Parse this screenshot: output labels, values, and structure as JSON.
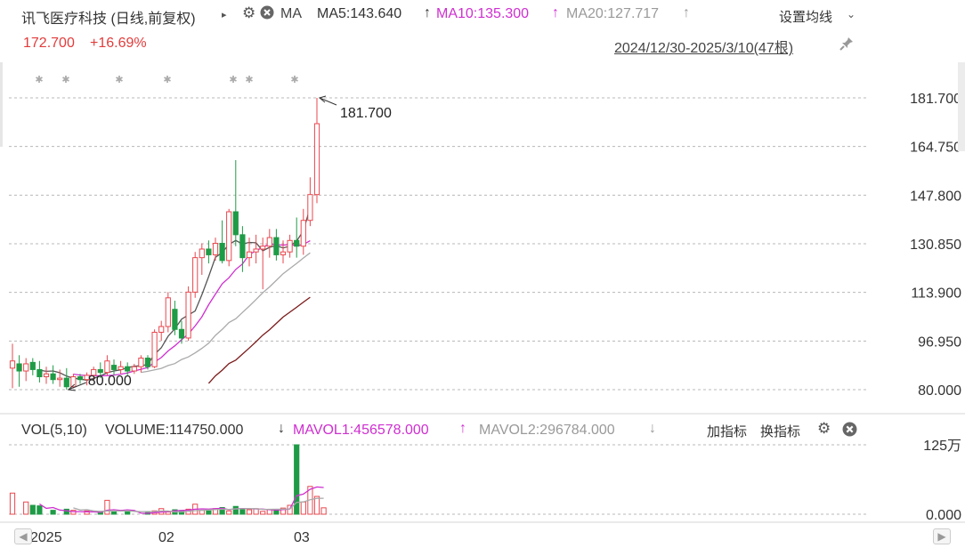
{
  "header": {
    "stock_title": "讯飞医疗科技 (日线,前复权)",
    "ma_label": "MA",
    "ma5": "MA5:143.640",
    "ma10": "MA10:135.300",
    "ma20": "MA20:127.717",
    "settings_label": "设置均线",
    "price": "172.700",
    "change_pct": "+16.69%",
    "date_range": "2024/12/30-2025/3/10(47根)"
  },
  "volume_header": {
    "vol_label": "VOL(5,10)",
    "volume": "VOLUME:114750.000",
    "mavol1": "MAVOL1:456578.000",
    "mavol2": "MAVOL2:296784.000",
    "add_indicator": "加指标",
    "switch_indicator": "换指标"
  },
  "x_axis_labels": [
    "2025",
    "02",
    "03"
  ],
  "colors": {
    "up": "#e8474e",
    "down": "#1e9b46",
    "ma5": "#555555",
    "ma10": "#cf2fd0",
    "ma20": "#aaaaaa",
    "ma60": "#7a1a1a",
    "price_text": "#e23c3c",
    "grid": "#bbbbbb"
  },
  "icons": [
    "triangle-right-icon",
    "gear-icon",
    "close-icon",
    "chevron-down-icon",
    "pin-icon",
    "arrow-up-icon",
    "arrow-down-icon",
    "scroll-left-icon",
    "scroll-right-icon"
  ],
  "chart_data": {
    "type": "candlestick",
    "price_axis": {
      "ticks": [
        "181.700",
        "164.750",
        "147.800",
        "130.850",
        "113.900",
        "96.950",
        "80.000"
      ],
      "ylim": [
        80,
        181.7
      ]
    },
    "volume_axis": {
      "ticks": [
        "125万",
        "0.000"
      ],
      "ylim": [
        0,
        1250000
      ]
    },
    "annotations": [
      {
        "label": "181.700",
        "type": "max"
      },
      {
        "label": "80.000",
        "type": "min"
      }
    ],
    "candles": [
      {
        "o": 87.5,
        "h": 96,
        "l": 80.5,
        "c": 90
      },
      {
        "o": 89,
        "h": 92,
        "l": 81,
        "c": 86.5
      },
      {
        "o": 86.5,
        "h": 91,
        "l": 83,
        "c": 89
      },
      {
        "o": 89.5,
        "h": 91,
        "l": 85,
        "c": 87
      },
      {
        "o": 87,
        "h": 90,
        "l": 82.5,
        "c": 84.5
      },
      {
        "o": 84.5,
        "h": 88,
        "l": 82,
        "c": 85.5
      },
      {
        "o": 85.5,
        "h": 88.5,
        "l": 82,
        "c": 83.5
      },
      {
        "o": 83.5,
        "h": 87,
        "l": 81,
        "c": 84
      },
      {
        "o": 84,
        "h": 87.5,
        "l": 80,
        "c": 81
      },
      {
        "o": 81,
        "h": 85.5,
        "l": 80.5,
        "c": 84.5
      },
      {
        "o": 84.5,
        "h": 85.5,
        "l": 82,
        "c": 83.5
      },
      {
        "o": 83.5,
        "h": 86,
        "l": 81.5,
        "c": 85
      },
      {
        "o": 85,
        "h": 88,
        "l": 83,
        "c": 87
      },
      {
        "o": 87,
        "h": 89.5,
        "l": 84,
        "c": 86
      },
      {
        "o": 86,
        "h": 92,
        "l": 85,
        "c": 90
      },
      {
        "o": 88.5,
        "h": 90.5,
        "l": 85,
        "c": 87
      },
      {
        "o": 87,
        "h": 90,
        "l": 85.5,
        "c": 88
      },
      {
        "o": 88,
        "h": 89.5,
        "l": 85,
        "c": 86.5
      },
      {
        "o": 86.5,
        "h": 89,
        "l": 85.5,
        "c": 88
      },
      {
        "o": 88,
        "h": 92,
        "l": 86,
        "c": 91
      },
      {
        "o": 91,
        "h": 92,
        "l": 87,
        "c": 88
      },
      {
        "o": 88,
        "h": 101,
        "l": 87.5,
        "c": 100
      },
      {
        "o": 100,
        "h": 104,
        "l": 97,
        "c": 102
      },
      {
        "o": 102,
        "h": 114,
        "l": 100,
        "c": 112
      },
      {
        "o": 108,
        "h": 111,
        "l": 99,
        "c": 101
      },
      {
        "o": 101,
        "h": 104,
        "l": 96,
        "c": 98
      },
      {
        "o": 98,
        "h": 116,
        "l": 97,
        "c": 114
      },
      {
        "o": 114,
        "h": 128,
        "l": 112,
        "c": 126
      },
      {
        "o": 126,
        "h": 131,
        "l": 120,
        "c": 129
      },
      {
        "o": 129,
        "h": 132,
        "l": 124,
        "c": 127
      },
      {
        "o": 127,
        "h": 133,
        "l": 125,
        "c": 131
      },
      {
        "o": 131,
        "h": 139,
        "l": 124,
        "c": 125
      },
      {
        "o": 125,
        "h": 143,
        "l": 123,
        "c": 142
      },
      {
        "o": 142,
        "h": 160,
        "l": 130,
        "c": 134
      },
      {
        "o": 134,
        "h": 137,
        "l": 121,
        "c": 126
      },
      {
        "o": 126,
        "h": 133,
        "l": 123,
        "c": 128
      },
      {
        "o": 128,
        "h": 134,
        "l": 124,
        "c": 129
      },
      {
        "o": 129,
        "h": 133,
        "l": 115,
        "c": 130
      },
      {
        "o": 130,
        "h": 136,
        "l": 126,
        "c": 133
      },
      {
        "o": 133,
        "h": 136,
        "l": 125,
        "c": 127
      },
      {
        "o": 127,
        "h": 132,
        "l": 124,
        "c": 128
      },
      {
        "o": 128,
        "h": 134,
        "l": 126,
        "c": 132
      },
      {
        "o": 132,
        "h": 140,
        "l": 126,
        "c": 130
      },
      {
        "o": 130,
        "h": 143,
        "l": 127,
        "c": 139
      },
      {
        "o": 139,
        "h": 154,
        "l": 137,
        "c": 148
      },
      {
        "o": 148,
        "h": 181.7,
        "l": 145,
        "c": 172.7
      }
    ],
    "volume": [
      380000,
      0,
      220000,
      160000,
      150000,
      0,
      70000,
      0,
      90000,
      70000,
      0,
      60000,
      0,
      50000,
      250000,
      40000,
      0,
      50000,
      0,
      0,
      30000,
      60000,
      100000,
      40000,
      80000,
      60000,
      90000,
      180000,
      70000,
      60000,
      100000,
      120000,
      60000,
      140000,
      90000,
      80000,
      100000,
      50000,
      80000,
      70000,
      110000,
      160000,
      1250000,
      220000,
      500000,
      320000,
      114750
    ],
    "ma_series": {
      "MA5": [
        null,
        null,
        null,
        null,
        86.8,
        86.4,
        86.5,
        85.9,
        84.7,
        84.0,
        83.7,
        83.3,
        83.9,
        84.8,
        85.9,
        86.5,
        86.9,
        87.7,
        88.2,
        88.3,
        88.8,
        92.3,
        94.6,
        98.6,
        101.2,
        104.6,
        106.0,
        107.4,
        113.1,
        119.4,
        126.1,
        127.8,
        130.6,
        132.0,
        130.8,
        131.3,
        131.2,
        128.4,
        129.6,
        130.2,
        129.4,
        130.0,
        131.8,
        135.3,
        143.6
      ],
      "MA10": [
        null,
        null,
        null,
        null,
        null,
        null,
        null,
        null,
        null,
        85.4,
        85.1,
        84.9,
        84.9,
        84.8,
        84.9,
        85.1,
        85.4,
        85.8,
        86.5,
        87.1,
        87.7,
        89.6,
        91.2,
        93.5,
        95.3,
        97.4,
        99.4,
        102.2,
        105.4,
        109.6,
        113.3,
        116.9,
        119.0,
        121.9,
        123.8,
        127.1,
        128.4,
        129.6,
        130.8,
        130.5,
        130.4,
        130.6,
        130.1,
        130.6,
        131.9
      ],
      "MA20": [
        null,
        null,
        null,
        null,
        null,
        null,
        null,
        null,
        null,
        null,
        null,
        null,
        null,
        null,
        null,
        null,
        null,
        null,
        null,
        86.0,
        86.4,
        86.9,
        87.4,
        88.4,
        89.1,
        90.5,
        91.4,
        92.8,
        94.4,
        96.2,
        98.9,
        101.0,
        103.4,
        104.7,
        106.9,
        109.1,
        111.4,
        113.8,
        115.8,
        118.1,
        120.4,
        122.2,
        124.0,
        125.9,
        127.7
      ],
      "MA60": [
        null,
        null,
        null,
        null,
        null,
        null,
        null,
        null,
        null,
        null,
        null,
        null,
        null,
        null,
        null,
        null,
        null,
        null,
        null,
        null,
        null,
        null,
        null,
        null,
        null,
        null,
        null,
        null,
        null,
        null,
        null,
        null,
        null,
        null,
        null,
        null,
        null,
        null,
        null,
        null,
        null,
        null,
        null,
        null,
        null
      ]
    }
  }
}
